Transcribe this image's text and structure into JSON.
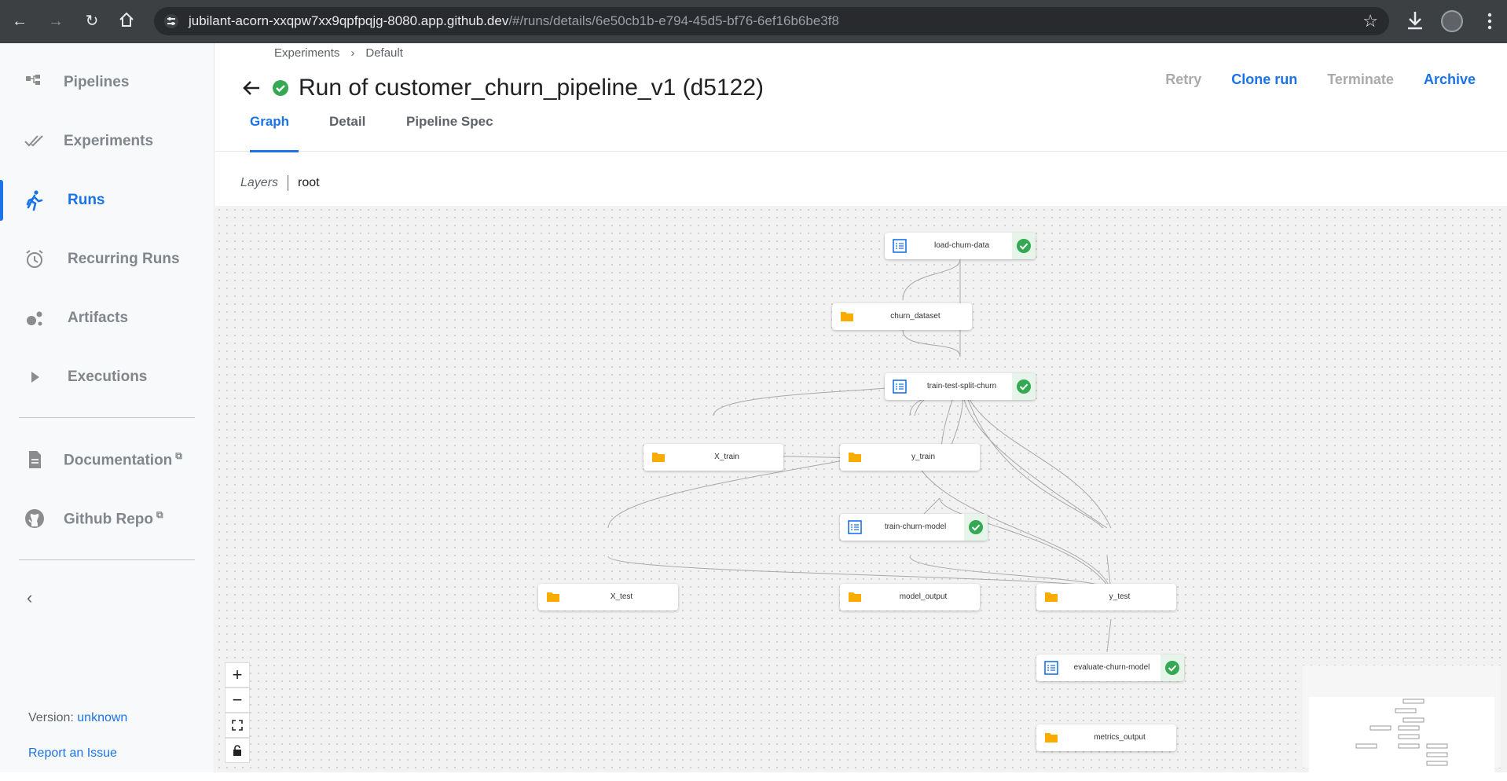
{
  "browser": {
    "url_host": "jubilant-acorn-xxqpw7xx9qpfpqjg-8080.app.github.dev",
    "url_path": "/#/runs/details/6e50cb1b-e794-45d5-bf76-6ef16b6be3f8",
    "icons": [
      "back-icon",
      "forward-icon",
      "reload-icon",
      "home-icon",
      "site-settings-icon",
      "star-icon",
      "download-icon",
      "avatar",
      "menu-icon"
    ]
  },
  "sidebar": {
    "items": [
      {
        "label": "Pipelines",
        "icon": "pipelines-icon",
        "active": false
      },
      {
        "label": "Experiments",
        "icon": "experiments-icon",
        "active": false
      },
      {
        "label": "Runs",
        "icon": "runs-icon",
        "active": true
      },
      {
        "label": "Recurring Runs",
        "icon": "alarm-icon",
        "active": false
      },
      {
        "label": "Artifacts",
        "icon": "artifacts-icon",
        "active": false
      },
      {
        "label": "Executions",
        "icon": "play-icon",
        "active": false
      }
    ],
    "links": [
      {
        "label": "Documentation",
        "icon": "document-icon"
      },
      {
        "label": "Github Repo",
        "icon": "github-icon"
      }
    ],
    "collapse_icon": "chevron-left-icon",
    "version_label": "Version:",
    "version_value": "unknown",
    "report_issue": "Report an Issue"
  },
  "header": {
    "breadcrumb": [
      "Experiments",
      "Default"
    ],
    "breadcrumb_sep": "›",
    "title": "Run of customer_churn_pipeline_v1 (d5122)",
    "status": "succeeded",
    "actions": [
      {
        "label": "Retry",
        "enabled": false
      },
      {
        "label": "Clone run",
        "enabled": true
      },
      {
        "label": "Terminate",
        "enabled": false
      },
      {
        "label": "Archive",
        "enabled": true
      }
    ]
  },
  "tabs": [
    {
      "label": "Graph",
      "active": true
    },
    {
      "label": "Detail",
      "active": false
    },
    {
      "label": "Pipeline Spec",
      "active": false
    }
  ],
  "layers": {
    "label": "Layers",
    "value": "root"
  },
  "graph": {
    "nodes": [
      {
        "label": "load-churn-data",
        "kind": "execution",
        "status": "success"
      },
      {
        "label": "churn_dataset",
        "kind": "artifact"
      },
      {
        "label": "train-test-split-churn",
        "kind": "execution",
        "status": "success"
      },
      {
        "label": "X_train",
        "kind": "artifact"
      },
      {
        "label": "y_train",
        "kind": "artifact"
      },
      {
        "label": "train-churn-model",
        "kind": "execution",
        "status": "success"
      },
      {
        "label": "X_test",
        "kind": "artifact"
      },
      {
        "label": "model_output",
        "kind": "artifact"
      },
      {
        "label": "y_test",
        "kind": "artifact"
      },
      {
        "label": "evaluate-churn-model",
        "kind": "execution",
        "status": "success"
      },
      {
        "label": "metrics_output",
        "kind": "artifact"
      }
    ],
    "controls": [
      "zoom-in",
      "zoom-out",
      "fit-view",
      "lock"
    ]
  },
  "colors": {
    "accent": "#1a73e8",
    "success": "#34a853",
    "folder": "#f9ab00"
  }
}
